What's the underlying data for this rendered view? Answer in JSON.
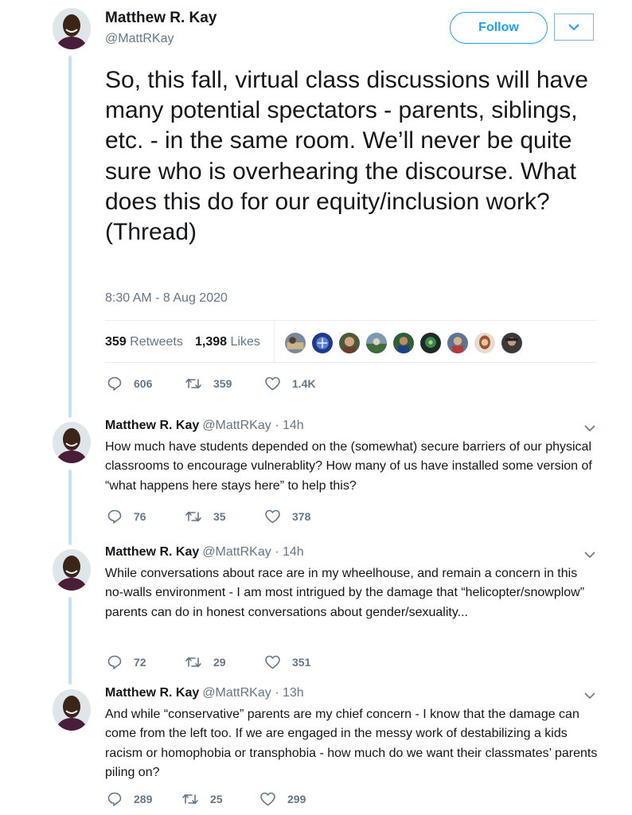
{
  "main_tweet": {
    "author_name": "Matthew R. Kay",
    "handle": "@MattRKay",
    "follow_label": "Follow",
    "text": "So, this fall, virtual class discussions will have many potential spectators - parents, siblings, etc. - in the same room. We’ll never be quite sure who is overhearing the discourse. What does this do for our equity/inclusion work? (Thread)",
    "timestamp": "8:30 AM - 8 Aug 2020",
    "retweets_count": "359",
    "retweets_label": "Retweets",
    "likes_count": "1,398",
    "likes_label": "Likes",
    "actions": {
      "replies": "606",
      "retweets": "359",
      "likes": "1.4K"
    }
  },
  "colors": {
    "accent": "#1da1f2",
    "thread_line": "#c4e2f6",
    "muted": "#657786"
  },
  "replies": [
    {
      "author_name": "Matthew R. Kay",
      "handle": "@MattRKay",
      "time": "· 14h",
      "text": "How much have students depended on the (somewhat) secure barriers of our physical classrooms to encourage vulnerablity? How many of us have installed some version of “what happens here stays here” to help this?",
      "actions": {
        "replies": "76",
        "retweets": "35",
        "likes": "378"
      }
    },
    {
      "author_name": "Matthew R. Kay",
      "handle": "@MattRKay",
      "time": "· 14h",
      "text": "While conversations about race are in my wheelhouse, and remain a concern in this no-walls environment - I am most intrigued by the damage that “helicopter/snowplow” parents can do in honest conversations about gender/sexuality...",
      "actions": {
        "replies": "72",
        "retweets": "29",
        "likes": "351"
      }
    },
    {
      "author_name": "Matthew R. Kay",
      "handle": "@MattRKay",
      "time": "· 13h",
      "text": "And while “conservative” parents are my chief concern - I know that the damage can come from the left too. If we are engaged in the messy work of destabilizing a kids racism or homophobia or transphobia - how much do we want their classmates’ parents piling on?",
      "actions": {
        "replies": "289",
        "retweets": "25",
        "likes": "299"
      }
    }
  ]
}
